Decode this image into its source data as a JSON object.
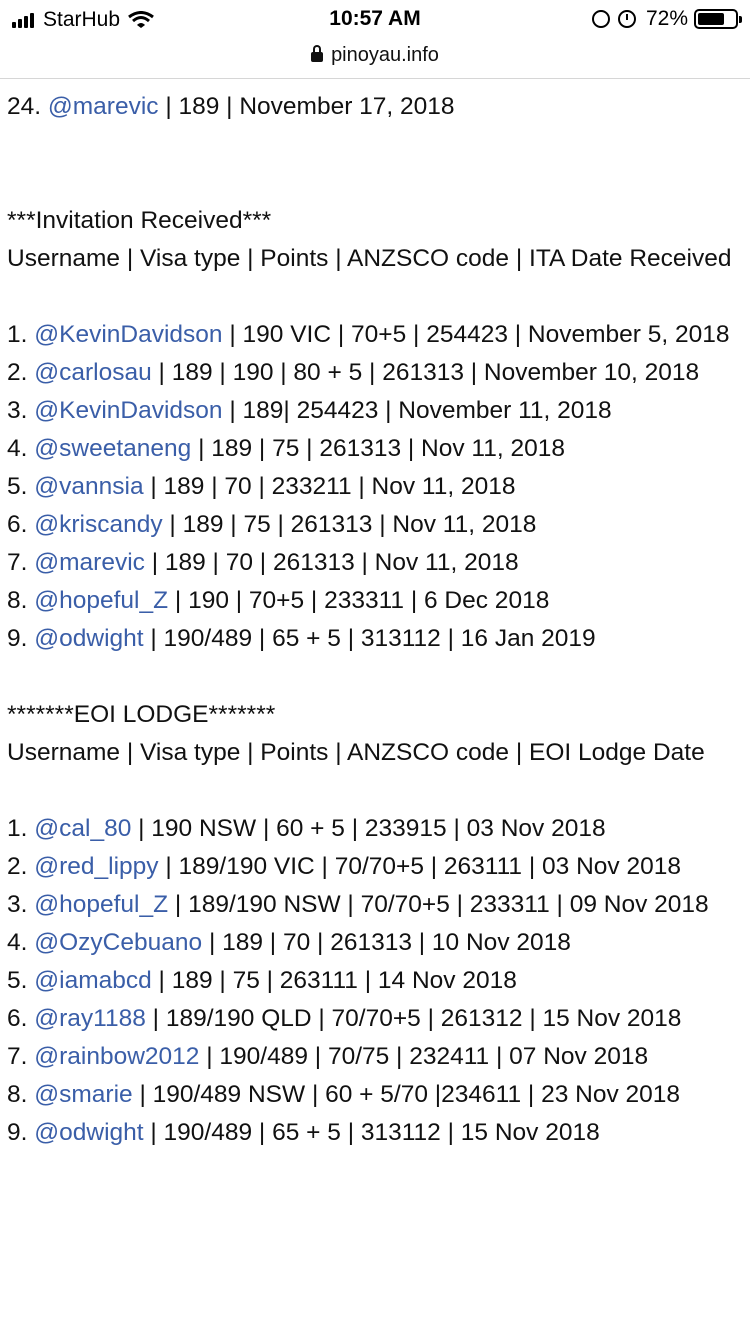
{
  "status_bar": {
    "carrier": "StarHub",
    "time": "10:57 AM",
    "battery_percent": "72%",
    "battery_level": 0.72,
    "icons": [
      "signal-icon",
      "wifi-icon",
      "rotation-lock-icon",
      "alarm-icon",
      "battery-icon"
    ]
  },
  "browser": {
    "url": "pinoyau.info",
    "lock_icon": "lock-icon"
  },
  "top": {
    "num": "24.",
    "user": "@marevic",
    "rest": " | 189 | November 17, 2018"
  },
  "ita": {
    "title": "***Invitation Received***",
    "header": "Username | Visa type | Points | ANZSCO code | ITA Date Received",
    "items": [
      {
        "num": "1.",
        "user": "@KevinDavidson",
        "rest": " | 190 VIC | 70+5 | 254423 | November 5, 2018"
      },
      {
        "num": "2.",
        "user": "@carlosau",
        "rest": " | 189 | 190 | 80 + 5 | 261313 | November 10, 2018"
      },
      {
        "num": "3.",
        "user": "@KevinDavidson",
        "rest": " | 189| 254423 | November 11, 2018"
      },
      {
        "num": "4.",
        "user": "@sweetaneng",
        "rest": " | 189 | 75 | 261313 | Nov 11, 2018"
      },
      {
        "num": "5.",
        "user": "@vannsia",
        "rest": " | 189 | 70 | 233211 | Nov 11, 2018"
      },
      {
        "num": "6.",
        "user": "@kriscandy",
        "rest": " | 189 | 75 | 261313 | Nov 11, 2018"
      },
      {
        "num": "7.",
        "user": "@marevic",
        "rest": " | 189 | 70 | 261313 | Nov 11, 2018"
      },
      {
        "num": "8.",
        "user": "@hopeful_Z",
        "rest": " | 190 | 70+5 | 233311 | 6 Dec 2018"
      },
      {
        "num": "9.",
        "user": "@odwight",
        "rest": " | 190/489 | 65 + 5 | 313112 | 16 Jan 2019"
      }
    ]
  },
  "eoi": {
    "title": "*******EOI LODGE*******",
    "header": "Username | Visa type | Points | ANZSCO code | EOI Lodge Date",
    "items": [
      {
        "num": "1.",
        "user": "@cal_80",
        "rest": " | 190 NSW | 60 + 5 | 233915 | 03 Nov 2018"
      },
      {
        "num": "2.",
        "user": "@red_lippy",
        "rest": " | 189/190 VIC | 70/70+5 | 263111 | 03 Nov 2018"
      },
      {
        "num": "3.",
        "user": "@hopeful_Z",
        "rest": " | 189/190 NSW | 70/70+5 | 233311 | 09 Nov 2018"
      },
      {
        "num": "4.",
        "user": "@OzyCebuano",
        "rest": " | 189 | 70 | 261313 | 10 Nov 2018"
      },
      {
        "num": "5.",
        "user": "@iamabcd",
        "rest": " | 189 | 75 | 263111 | 14 Nov 2018"
      },
      {
        "num": "6.",
        "user": "@ray1188",
        "rest": " | 189/190 QLD | 70/70+5 | 261312 | 15 Nov 2018"
      },
      {
        "num": "7.",
        "user": "@rainbow2012",
        "rest": " | 190/489 | 70/75 | 232411 | 07 Nov 2018"
      },
      {
        "num": "8.",
        "user": "@smarie",
        "rest": " | 190/489 NSW | 60 + 5/70 |234611 | 23 Nov 2018"
      },
      {
        "num": "9.",
        "user": "@odwight",
        "rest": " | 190/489 | 65 + 5 | 313112 | 15 Nov 2018"
      }
    ]
  }
}
